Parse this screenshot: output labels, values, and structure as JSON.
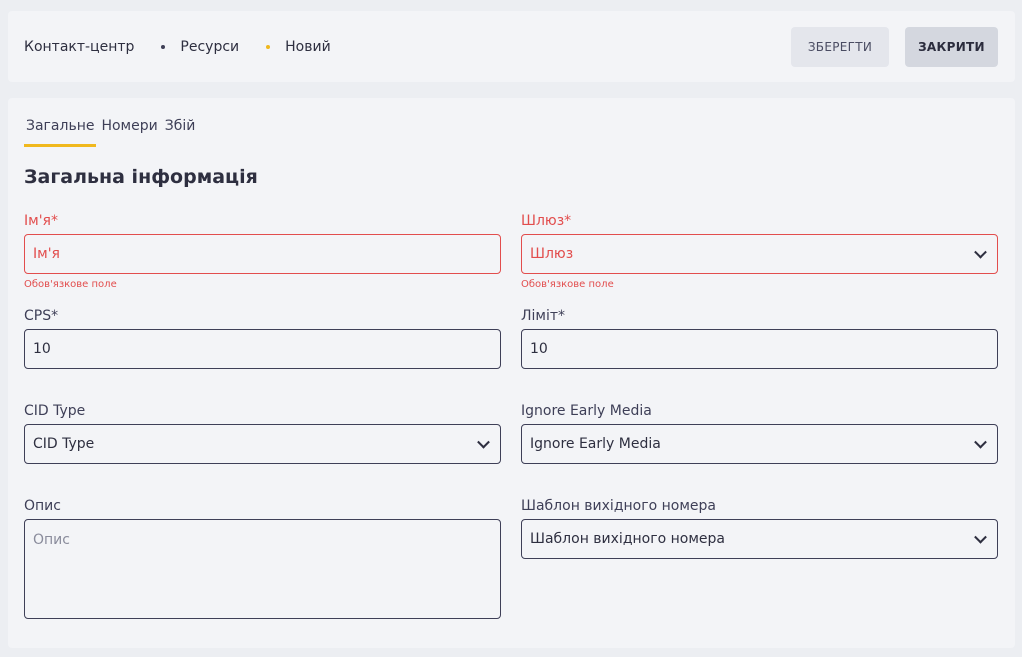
{
  "breadcrumb": {
    "items": [
      "Контакт-центр",
      "Ресурси",
      "Новий"
    ]
  },
  "actions": {
    "save_label": "ЗБЕРЕГТИ",
    "close_label": "ЗАКРИТИ"
  },
  "tabs": [
    {
      "label": "Загальне",
      "active": true
    },
    {
      "label": "Номери",
      "active": false
    },
    {
      "label": "Збій",
      "active": false
    }
  ],
  "section_title": "Загальна інформація",
  "fields": {
    "name": {
      "label": "Ім'я*",
      "placeholder": "Ім'я",
      "value": "",
      "error": "Обов'язкове поле"
    },
    "gateway": {
      "label": "Шлюз*",
      "placeholder": "Шлюз",
      "value": "",
      "error": "Обов'язкове поле"
    },
    "cps": {
      "label": "CPS*",
      "value": "10"
    },
    "limit": {
      "label": "Ліміт*",
      "value": "10"
    },
    "cid_type": {
      "label": "CID Type",
      "placeholder": "CID Type"
    },
    "ignore_early_media": {
      "label": "Ignore Early Media",
      "placeholder": "Ignore Early Media"
    },
    "description": {
      "label": "Опис",
      "placeholder": "Опис",
      "value": ""
    },
    "outbound_template": {
      "label": "Шаблон вихідного номера",
      "placeholder": "Шаблон вихідного номера"
    }
  },
  "colors": {
    "accent": "#f0b81e",
    "error": "#e24d4d",
    "border": "#3e3f57"
  }
}
